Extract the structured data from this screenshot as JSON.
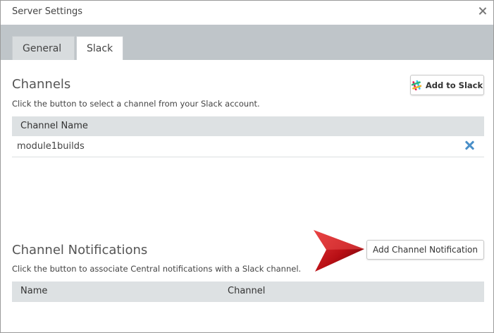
{
  "window": {
    "title": "Server Settings"
  },
  "tabs": [
    {
      "label": "General",
      "active": false
    },
    {
      "label": "Slack",
      "active": true
    }
  ],
  "channels": {
    "title": "Channels",
    "description": "Click the button to select a channel from your Slack account.",
    "add_button_label": "Add to Slack",
    "columns": [
      "Channel Name"
    ],
    "rows": [
      {
        "name": "module1builds"
      }
    ]
  },
  "notifications": {
    "title": "Channel Notifications",
    "description": "Click the button to associate Central notifications with a Slack channel.",
    "add_button_label": "Add Channel Notification",
    "columns": [
      "Name",
      "Channel"
    ]
  },
  "colors": {
    "tabstrip": "#bfc5c9",
    "table_header": "#dde1e3",
    "remove_icon": "#4a8fc8",
    "arrow": "#c0141a"
  },
  "icons": [
    "close-icon",
    "slack-logo-icon",
    "remove-icon",
    "pointer-arrow-icon"
  ]
}
